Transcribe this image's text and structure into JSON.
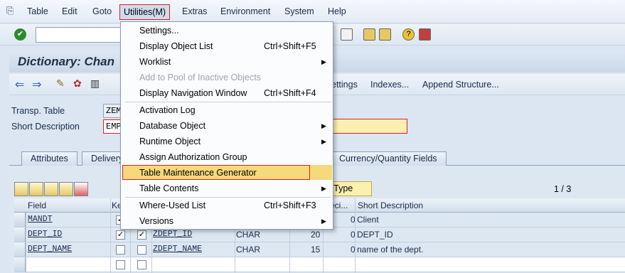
{
  "menubar": {
    "items": [
      "Table",
      "Edit",
      "Goto",
      "Utilities(M)",
      "Extras",
      "Environment",
      "System",
      "Help"
    ],
    "active": "Utilities(M)"
  },
  "title": "Dictionary: Chan",
  "apptoolbar": {
    "buttons": [
      "ettings",
      "Indexes...",
      "Append Structure..."
    ]
  },
  "form": {
    "transp_table_label": "Transp. Table",
    "transp_table_value": "ZEM",
    "short_desc_label": "Short Description",
    "short_desc_value": "EMP"
  },
  "tabs": [
    "Attributes",
    "Delivery",
    "Currency/Quantity Fields"
  ],
  "table": {
    "page_indicator": "1  /  3",
    "data_type_btn": "ed Type",
    "headers": {
      "field": "Field",
      "key": "Ke",
      "deci": "eci...",
      "short_desc": "Short Description"
    },
    "rows": [
      {
        "field": "MANDT",
        "key": true,
        "initial": false,
        "dataelem": "",
        "type": "",
        "len": "",
        "dec": "0",
        "desc": "Client"
      },
      {
        "field": "DEPT_ID",
        "key": true,
        "initial": true,
        "dataelem": "ZDEPT_ID",
        "type": "CHAR",
        "len": "20",
        "dec": "0",
        "desc": "DEPT_ID"
      },
      {
        "field": "DEPT_NAME",
        "key": false,
        "initial": false,
        "dataelem": "ZDEPT_NAME",
        "type": "CHAR",
        "len": "15",
        "dec": "0",
        "desc": "name of the dept."
      },
      {
        "field": "",
        "key": false,
        "initial": false,
        "dataelem": "",
        "type": "",
        "len": "",
        "dec": "",
        "desc": ""
      }
    ]
  },
  "dropdown": {
    "items": [
      {
        "label": "Settings...",
        "shortcut": "",
        "submenu": false,
        "disabled": false
      },
      {
        "label": "Display Object List",
        "shortcut": "Ctrl+Shift+F5",
        "submenu": false,
        "disabled": false
      },
      {
        "label": "Worklist",
        "shortcut": "",
        "submenu": true,
        "disabled": false
      },
      {
        "label": "Add to Pool of Inactive Objects",
        "shortcut": "",
        "submenu": false,
        "disabled": true
      },
      {
        "label": "Display Navigation Window",
        "shortcut": "Ctrl+Shift+F4",
        "submenu": false,
        "disabled": false
      },
      {
        "label": "Activation Log",
        "shortcut": "",
        "submenu": false,
        "disabled": false
      },
      {
        "label": "Database Object",
        "shortcut": "",
        "submenu": true,
        "disabled": false
      },
      {
        "label": "Runtime Object",
        "shortcut": "",
        "submenu": true,
        "disabled": false
      },
      {
        "label": "Assign Authorization Group",
        "shortcut": "",
        "submenu": false,
        "disabled": false
      },
      {
        "label": "Table Maintenance Generator",
        "shortcut": "",
        "submenu": false,
        "disabled": false
      },
      {
        "label": "Table Contents",
        "shortcut": "",
        "submenu": true,
        "disabled": false
      },
      {
        "label": "Where-Used List",
        "shortcut": "Ctrl+Shift+F3",
        "submenu": false,
        "disabled": false
      },
      {
        "label": "Versions",
        "shortcut": "",
        "submenu": true,
        "disabled": false
      }
    ],
    "highlighted": "Table Maintenance Generator"
  },
  "colors": {
    "highlight": "#f6d97a",
    "focus_border": "#d92020",
    "background": "#dbe6f2"
  }
}
